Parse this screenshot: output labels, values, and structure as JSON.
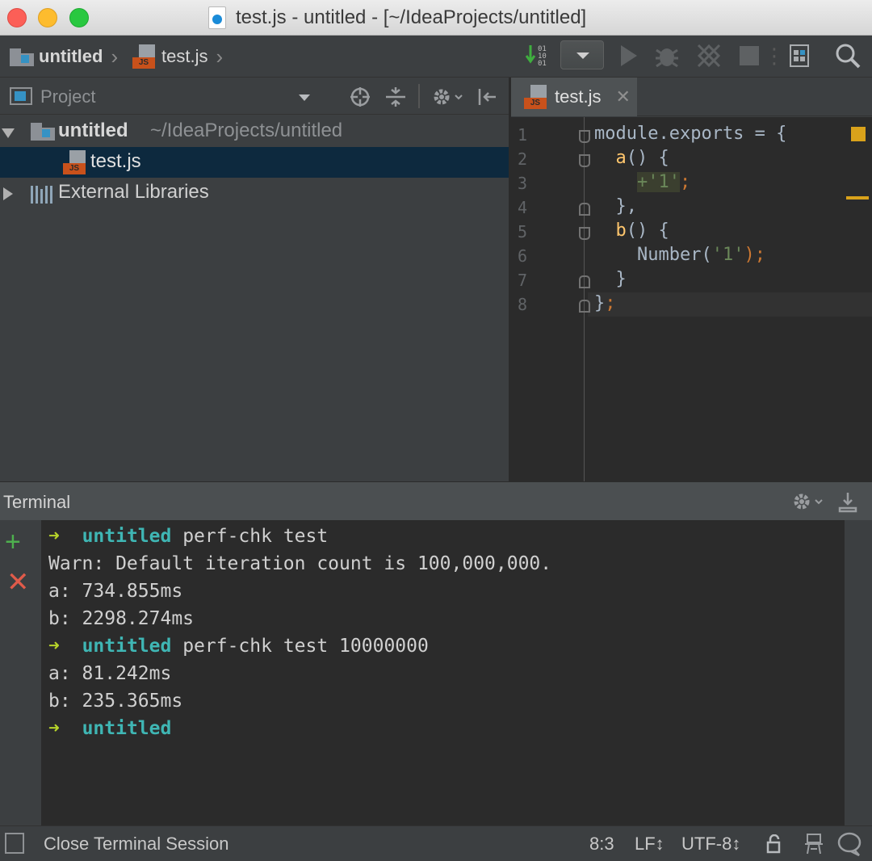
{
  "window": {
    "title": "test.js - untitled - [~/IdeaProjects/untitled]"
  },
  "navbar": {
    "breadcrumb": [
      "untitled",
      "test.js"
    ]
  },
  "project_panel": {
    "title": "Project",
    "tree": [
      {
        "label": "untitled",
        "path": "~/IdeaProjects/untitled"
      },
      {
        "label": "test.js"
      },
      {
        "label": "External Libraries"
      }
    ]
  },
  "editor": {
    "tab_label": "test.js",
    "line_numbers": [
      "1",
      "2",
      "3",
      "4",
      "5",
      "6",
      "7",
      "8"
    ],
    "lines": [
      {
        "a": "module.exports = {"
      },
      {
        "a": "  ",
        "b": "a",
        "c": "() {"
      },
      {
        "a": "    ",
        "b": "+'1'",
        "c": ";"
      },
      {
        "a": "  },"
      },
      {
        "a": "  ",
        "b": "b",
        "c": "() {"
      },
      {
        "a": "    Number(",
        "b": "'1'",
        "c": ");"
      },
      {
        "a": "  }"
      },
      {
        "a": "}",
        "b": ";"
      }
    ]
  },
  "terminal": {
    "title": "Terminal",
    "lines": [
      {
        "prompt": "➜",
        "dir": "untitled",
        "cmd": " perf-chk test"
      },
      {
        "text": "Warn: Default iteration count is 100,000,000."
      },
      {
        "text": "a: 734.855ms"
      },
      {
        "text": "b: 2298.274ms"
      },
      {
        "prompt": "➜",
        "dir": "untitled",
        "cmd": " perf-chk test 10000000"
      },
      {
        "text": "a: 81.242ms"
      },
      {
        "text": "b: 235.365ms"
      },
      {
        "prompt": "➜",
        "dir": "untitled",
        "cmd": ""
      }
    ]
  },
  "statusbar": {
    "message": "Close Terminal Session",
    "position": "8:3",
    "line_sep": "LF↕",
    "encoding": "UTF-8↕"
  }
}
